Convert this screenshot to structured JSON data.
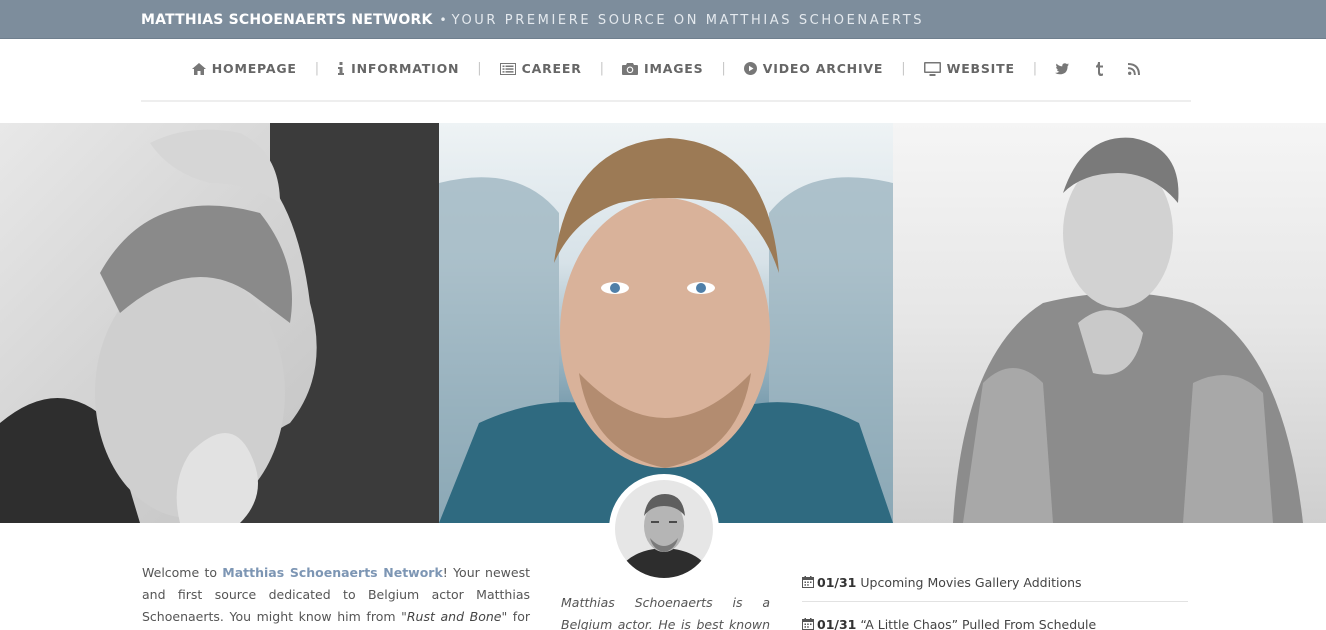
{
  "header": {
    "site_name": "MATTHIAS SCHOENAERTS NETWORK",
    "separator": "•",
    "tagline": "YOUR PREMIERE SOURCE ON MATTHIAS SCHOENAERTS"
  },
  "nav": {
    "items": [
      {
        "label": "HOMEPAGE",
        "icon": "home-icon"
      },
      {
        "label": "INFORMATION",
        "icon": "info-icon"
      },
      {
        "label": "CAREER",
        "icon": "list-icon"
      },
      {
        "label": "IMAGES",
        "icon": "camera-icon"
      },
      {
        "label": "VIDEO ARCHIVE",
        "icon": "play-circle-icon"
      },
      {
        "label": "WEBSITE",
        "icon": "monitor-icon"
      }
    ],
    "social": [
      "twitter-icon",
      "tumblr-icon",
      "rss-icon"
    ],
    "separator": "|"
  },
  "welcome": {
    "intro": "Welcome to ",
    "brand": "Matthias Schoenaerts Network",
    "text1": "! Your newest and first source dedicated to Belgium actor Matthias Schoenaerts. You might know him from \"",
    "film": "Rust and Bone",
    "text2": "\" for which he won a"
  },
  "bio": {
    "text": "Matthias Schoenaerts is a Belgium actor. He is best known for his roles"
  },
  "news": [
    {
      "date": "01/31",
      "title": "Upcoming Movies Gallery Additions"
    },
    {
      "date": "01/31",
      "title": "“A Little Chaos” Pulled From Schedule"
    }
  ],
  "colors": {
    "topbar": "#7d8d9c",
    "accent": "#7d96b4"
  }
}
